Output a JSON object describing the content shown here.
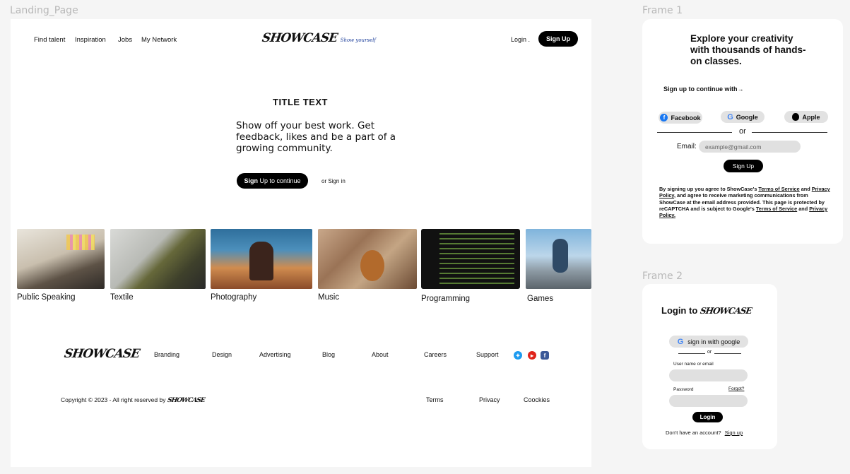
{
  "labels": {
    "landing": "Landing_Page",
    "frame1": "Frame 1",
    "frame2": "Frame 2"
  },
  "nav": {
    "links": [
      "Find talent",
      "Inspiration",
      "Jobs",
      "My Network"
    ],
    "logo": "SHOWCASE",
    "tagline": "Show yourself",
    "login": "Login .",
    "signup": "Sign Up"
  },
  "hero": {
    "title": "TITLE TEXT",
    "subtitle": "Show off your best work. Get feedback, likes and be a part of a growing community.",
    "cta_bold": "Sign",
    "cta_rest": " Up to continue",
    "signin": "or Sign in"
  },
  "categories": [
    "Public Speaking",
    "Textile",
    "Photography",
    "Music",
    "Programming",
    "Games"
  ],
  "footer": {
    "logo": "SHOWCASE",
    "links": [
      "Branding",
      "Design",
      "Advertising",
      "Blog",
      "About",
      "Careers",
      "Support"
    ],
    "copyright": "Copyright © 2023 - All right reserved by",
    "copyright_logo": "SHOWCASE",
    "legal": [
      "Terms",
      "Privacy",
      "Coockies"
    ],
    "social_icons": [
      "twitter-icon",
      "youtube-icon",
      "facebook-icon"
    ]
  },
  "frame1": {
    "heading": "Explore your creativity with thousands of hands-on classes.",
    "continue_with": "Sign up to continue with→",
    "providers": [
      "Facebook",
      "Google",
      "Apple"
    ],
    "or": "or",
    "email_label": "Email:",
    "email_placeholder": "example@gmail.com",
    "signup": "Sign Up",
    "legal_1": "By signing up you agree to ShowCase's ",
    "tos": "Terms of Service",
    "legal_2": " and ",
    "privacy": "Privacy Policy",
    "legal_3": ", and agree to receive marketing communications from ShowCase at the email address provided. This page is protected by reCAPTCHA and is subject to Google's ",
    "tos2": "Terms of Service",
    "legal_4": " and ",
    "privacy2": "Privacy Policy."
  },
  "frame2": {
    "heading": "Login to",
    "logo": "SHOWCASE",
    "google": "sign in with google",
    "or": "or",
    "username_label": "User name or email",
    "password_label": "Password",
    "forgot": "Forgot?",
    "login": "Login",
    "no_account": "Don't have an account?",
    "signup": "Sign up"
  },
  "colors": {
    "accent": "#000000",
    "tagline": "#1a3c9a",
    "twitter": "#1d9bf0",
    "youtube": "#e0241b",
    "facebook": "#3b5998"
  }
}
